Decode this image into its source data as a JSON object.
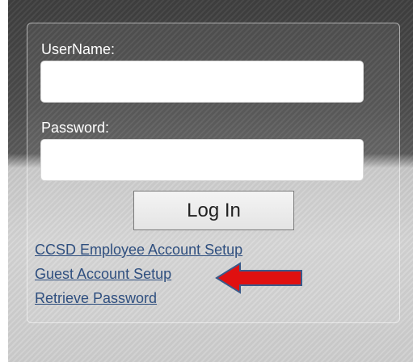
{
  "login": {
    "username_label": "UserName:",
    "username_value": "",
    "password_label": "Password:",
    "password_value": "",
    "login_button": "Log In"
  },
  "links": {
    "employee_setup": "CCSD Employee Account Setup",
    "guest_setup": "Guest Account Setup",
    "retrieve_password": "Retrieve Password"
  },
  "annotation": {
    "arrow_icon": "red-arrow-left-icon",
    "arrow_color": "#e01010",
    "arrow_outline": "#3a5a8a"
  },
  "colors": {
    "link": "#2f4f7f",
    "label": "#ffffff"
  }
}
